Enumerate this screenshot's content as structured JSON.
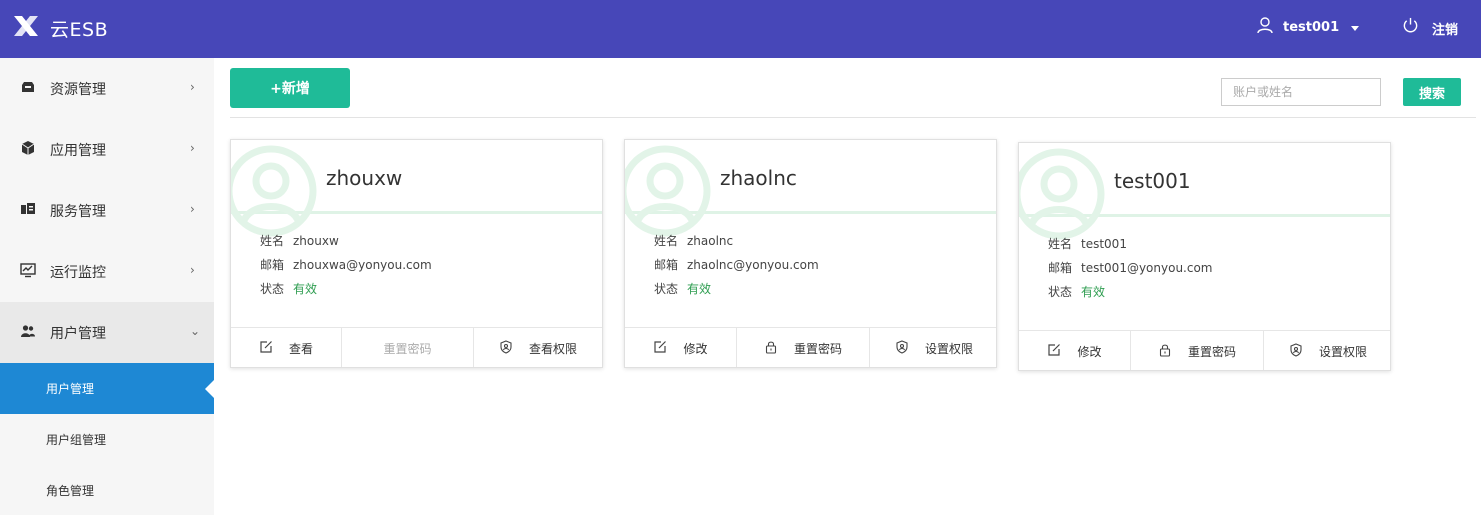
{
  "app": {
    "title": "云ESB"
  },
  "header": {
    "username": "test001",
    "logout_label": "注销"
  },
  "sidebar": {
    "items": [
      {
        "label": "资源管理",
        "icon": "resource-icon"
      },
      {
        "label": "应用管理",
        "icon": "cube-icon"
      },
      {
        "label": "服务管理",
        "icon": "service-icon"
      },
      {
        "label": "运行监控",
        "icon": "monitor-icon"
      },
      {
        "label": "用户管理",
        "icon": "users-icon",
        "expanded": true
      }
    ],
    "subitems": [
      {
        "label": "用户管理",
        "active": true
      },
      {
        "label": "用户组管理"
      },
      {
        "label": "角色管理"
      }
    ]
  },
  "toolbar": {
    "add_label": "+新增",
    "search_placeholder": "账户或姓名",
    "search_label": "搜索"
  },
  "field_labels": {
    "name": "姓名",
    "email": "邮箱",
    "status": "状态"
  },
  "cards": [
    {
      "title": "zhouxw",
      "name": "zhouxw",
      "email": "zhouxwa@yonyou.com",
      "status": "有效",
      "actions": [
        "查看",
        "重置密码",
        "查看权限"
      ]
    },
    {
      "title": "zhaolnc",
      "name": "zhaolnc",
      "email": "zhaolnc@yonyou.com",
      "status": "有效",
      "actions": [
        "修改",
        "重置密码",
        "设置权限"
      ]
    },
    {
      "title": "test001",
      "name": "test001",
      "email": "test001@yonyou.com",
      "status": "有效",
      "actions": [
        "修改",
        "重置密码",
        "设置权限"
      ]
    }
  ],
  "colors": {
    "header": "#4747b8",
    "accent": "#1fbb98",
    "active": "#1e88d4",
    "status_ok": "#2e9d50"
  }
}
